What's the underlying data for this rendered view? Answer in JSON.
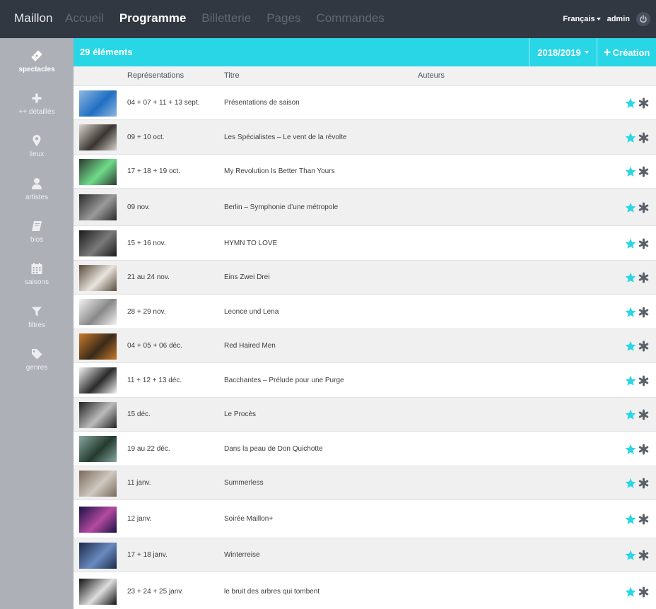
{
  "app": {
    "brand": "Maillon",
    "nav": [
      {
        "label": "Accueil",
        "active": false
      },
      {
        "label": "Programme",
        "active": true
      },
      {
        "label": "Billetterie",
        "active": false
      },
      {
        "label": "Pages",
        "active": false
      },
      {
        "label": "Commandes",
        "active": false
      }
    ],
    "language": "Français",
    "user": "admin",
    "power_icon": "power-icon"
  },
  "sidebar": {
    "items": [
      {
        "label": "spectacles",
        "icon": "ticket-icon",
        "active": true
      },
      {
        "label": "++ détaillés",
        "icon": "plus-icon",
        "active": false
      },
      {
        "label": "lieux",
        "icon": "map-marker-icon",
        "active": false
      },
      {
        "label": "artistes",
        "icon": "user-icon",
        "active": false
      },
      {
        "label": "bios",
        "icon": "book-icon",
        "active": false
      },
      {
        "label": "saisons",
        "icon": "calendar-icon",
        "active": false
      },
      {
        "label": "filtres",
        "icon": "filter-icon",
        "active": false
      },
      {
        "label": "genres",
        "icon": "tag-icon",
        "active": false
      }
    ]
  },
  "list": {
    "count_label": "29 éléments",
    "season": "2018/2019",
    "create_label": "Création",
    "columns": [
      "Représentations",
      "Titre",
      "Auteurs"
    ]
  },
  "rows": [
    {
      "dates": "04 + 07 + 11 + 13 sept.",
      "title": "Présentations de saison"
    },
    {
      "dates": "09 + 10 oct.",
      "title": "Les Spécialistes – Le vent de la révolte"
    },
    {
      "dates": "17 + 18 + 19 oct.",
      "title": "My Revolution Is Better Than Yours"
    },
    {
      "dates": "09 nov.",
      "title": "Berlin – Symphonie d’une métropole"
    },
    {
      "dates": "15 + 16 nov.",
      "title": "HYMN TO LOVE"
    },
    {
      "dates": "21 au 24 nov.",
      "title": "Eins Zwei Drei"
    },
    {
      "dates": "28 + 29 nov.",
      "title": "Leonce und Lena"
    },
    {
      "dates": "04 + 05 + 06 déc.",
      "title": "Red Haired Men"
    },
    {
      "dates": "11 + 12 + 13 déc.",
      "title": "Bacchantes – Prélude pour une Purge"
    },
    {
      "dates": "15 déc.",
      "title": "Le Procès"
    },
    {
      "dates": "19 au 22 déc.",
      "title": "Dans la peau de Don Quichotte"
    },
    {
      "dates": "11 janv.",
      "title": "Summerless"
    },
    {
      "dates": "12 janv.",
      "title": "Soirée Maillon+"
    },
    {
      "dates": "17 + 18 janv.",
      "title": "Winterreise"
    },
    {
      "dates": "23 + 24 + 25 janv.",
      "title": "le bruit des arbres qui tombent"
    }
  ],
  "colors": {
    "navbar": "#313842",
    "accent": "#28d6e6",
    "sidebar": "#adb1b7",
    "star": "#28d6e6",
    "gear": "#5a6068"
  }
}
